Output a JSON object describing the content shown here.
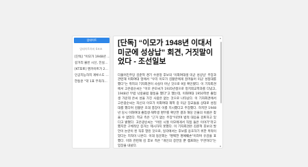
{
  "sidebar": {
    "update_button": "업데이트",
    "count_text": "업데이트하지 6초초",
    "items": [
      {
        "label": "[단독] \"이모가 1948년 이대서"
      },
      {
        "label": "길거리 불빈 시신, 진실규명"
      },
      {
        "label": "[KT포토] 멘카이트가 2부에"
      },
      {
        "label": "인공지능하지 게루스도 못해"
      },
      {
        "label": "한동훈 \"약 1표 부족하면 원래"
      }
    ]
  },
  "article": {
    "title": "[단독] “이모가 1948년 이대서 미군에 성상납” 회견, 거짓말이었다 - 조선일보",
    "body": "더불어민주당 김준혁 경기 수원정 후보의 '이화여대생 미군 성상납' 주장과 관련해 이화여대 앞에서 \"우리 이모가 김활란에게 끌려들어 미군 성접대를 했다\"는 취지의 기자회견이 사실이 아닌 것으로 9일 확인됐다. 이 기자회견에서 고은광순씨는 \"이모 은모씨가 1935년생으로 정치외교학과를 다녔고, 1948년 무렵 낙랑클럽 활동을 했다\"고 했는데, 이화여대 1950학번 졸업생 가운데 은씨 성을 가진 사람은 없는 것으로 나타났다. 이 기자회견에서 고은광순씨는 자신의 이모가 이화여대 재학 중 미군 장교들을 상대로 성접대를 했다며 김활란 초대 총장이 이를 지시했다고 주장했다. 하지만 1948년 당시 이화여대 졸업생·재학생 명부를 확인한 결과 해당 인물의 이름은 찾을 수 없었다. 학교 측은 \"근거 없는 주장\"이라며 법적 대응을 검토하고 있다고 밝혔다. 고은광순씨는 \"어린 시절 이모에게서 직접 들은 이야기\"라고 했지만 구체적인 증거는 제시하지 못했다. 이 기자회견은 김준혁 후보의 발언이 논란이 된 직후 열린 것으로, 일각에서는 후보를 옹호하기 위한 목적이었다는 지적이 나온다. 이대 동문회는 \"명백한 명예훼손\"이라며 유감을 표했다. 이와 관련해 김 후보 측은 \"개인의 증언일 뿐 캠프와는 무관하다\"는 입장을 내놨다."
  }
}
